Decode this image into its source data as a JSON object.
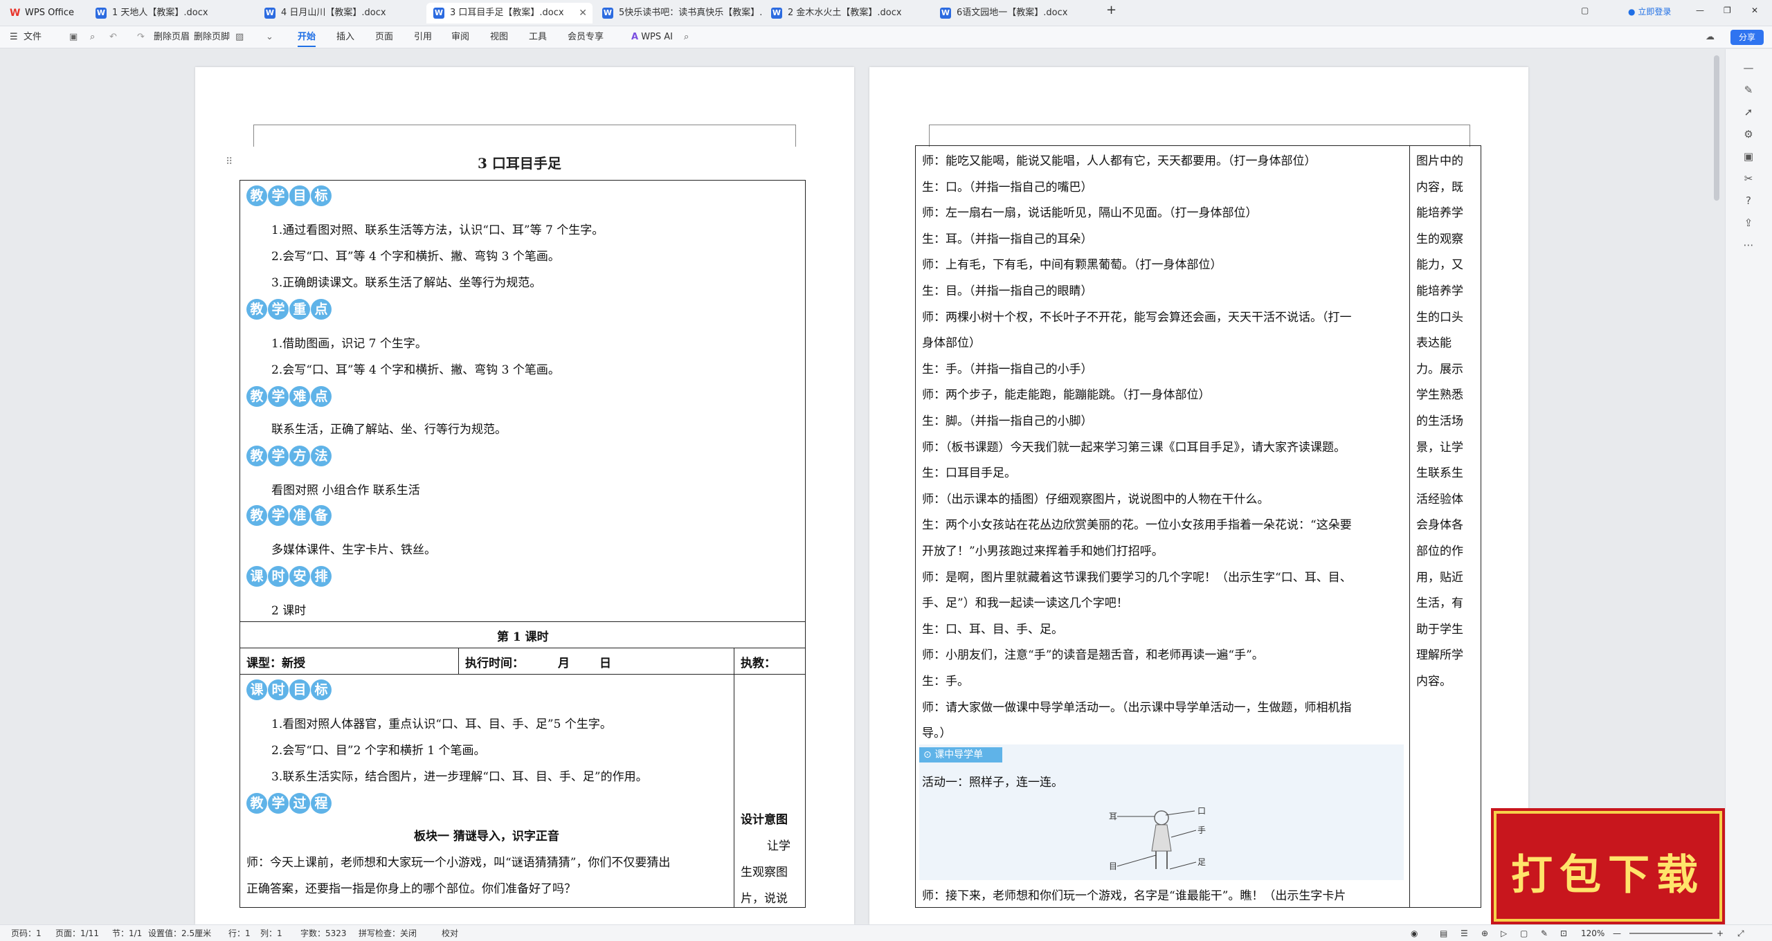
{
  "app": {
    "name": "WPS Office"
  },
  "tabs": [
    {
      "label": "1 天地人【教案】.docx"
    },
    {
      "label": "4 日月山川【教案】.docx"
    },
    {
      "label": "3 口耳目手足【教案】.docx"
    },
    {
      "label": "5快乐读书吧：读书真快乐【教案】.d"
    },
    {
      "label": "2 金木水火土【教案】.docx"
    },
    {
      "label": "6语文园地一【教案】.docx"
    }
  ],
  "topbar": {
    "login": "立即登录",
    "new_tab": "+"
  },
  "menu": {
    "file": "文件",
    "del_header": "删除页眉",
    "del_footer": "删除页脚",
    "items": [
      "开始",
      "插入",
      "页面",
      "引用",
      "审阅",
      "视图",
      "工具",
      "会员专享"
    ],
    "ai": "WPS AI",
    "share": "分享"
  },
  "page1": {
    "title": "3  口耳目手足",
    "sections": {
      "goals_badge": [
        "教",
        "学",
        "目",
        "标"
      ],
      "goals": [
        "1.通过看图对照、联系生活等方法，认识“口、耳”等 7 个生字。",
        "2.会写“口、耳”等 4 个字和横折、撇、弯钩 3 个笔画。",
        "3.正确朗读课文。联系生活了解站、坐等行为规范。"
      ],
      "key_badge": [
        "教",
        "学",
        "重",
        "点"
      ],
      "key": [
        "1.借助图画，识记 7 个生字。",
        "2.会写“口、耳”等 4 个字和横折、撇、弯钩 3 个笔画。"
      ],
      "diff_badge": [
        "教",
        "学",
        "难",
        "点"
      ],
      "diff": "联系生活，正确了解站、坐、行等行为规范。",
      "method_badge": [
        "教",
        "学",
        "方",
        "法"
      ],
      "method": "看图对照    小组合作    联系生活",
      "prep_badge": [
        "教",
        "学",
        "准",
        "备"
      ],
      "prep": "多媒体课件、生字卡片、铁丝。",
      "hours_badge": [
        "课",
        "时",
        "安",
        "排"
      ],
      "hours": "2 课时"
    },
    "lesson": "第 1 课时",
    "type_label": "课型：新授",
    "time_label": "执行时间：",
    "month": "月",
    "day": "日",
    "teacher_label": "执教：",
    "lgoals_badge": [
      "课",
      "时",
      "目",
      "标"
    ],
    "lgoals": [
      "1.看图对照人体器官，重点认识“口、耳、目、手、足”5 个生字。",
      "2.会写“口、目”2 个字和横折 1 个笔画。",
      "3.联系生活实际，结合图片，进一步理解“口、耳、目、手、足”的作用。"
    ],
    "process_badge": [
      "教",
      "学",
      "过",
      "程"
    ],
    "block1": "板块一    猜谜导入，识字正音",
    "intro1": "师：今天上课前，老师想和大家玩一个小游戏，叫“谜语猜猜猜”，你们不仅要猜出",
    "intro2": "正确答案，还要指一指是你身上的哪个部位。你们准备好了吗？",
    "design_title": "设计意图",
    "design_lines": [
      "让学",
      "生观察图",
      "片，说说"
    ]
  },
  "page2": {
    "lines": [
      "师：能吃又能喝，能说又能唱，人人都有它，天天都要用。（打一身体部位）",
      "生：口。（并指一指自己的嘴巴）",
      "师：左一扇右一扇，说话能听见，隔山不见面。（打一身体部位）",
      "生：耳。（并指一指自己的耳朵）",
      "师：上有毛，下有毛，中间有颗黑葡萄。（打一身体部位）",
      "生：目。（并指一指自己的眼睛）",
      "师：两棵小树十个杈，不长叶子不开花，能写会算还会画，天天干活不说话。（打一",
      "身体部位）",
      "生：手。（并指一指自己的小手）",
      "师：两个步子，能走能跑，能蹦能跳。（打一身体部位）",
      "生：脚。（并指一指自己的小脚）",
      "师：（板书课题）今天我们就一起来学习第三课《口耳目手足》，请大家齐读课题。",
      "生：口耳目手足。",
      "师：（出示课本的插图）仔细观察图片，说说图中的人物在干什么。",
      "生：两个小女孩站在花丛边欣赏美丽的花。一位小女孩用手指着一朵花说：“这朵要",
      "开放了！”小男孩跑过来挥着手和她们打招呼。",
      "师：是啊，图片里就藏着这节课我们要学习的几个字呢！（出示生字“口、耳、目、",
      "手、足”）和我一起读一读这几个字吧！",
      "生：口、耳、目、手、足。",
      "师：小朋友们，注意“手”的读音是翘舌音，和老师再读一遍“手”。",
      "生：手。",
      "师：请大家做一做课中导学单活动一。（出示课中导学单活动一，生做题，师相机指",
      "导。）"
    ],
    "guide_label": "课中导学单",
    "activity": "活动一：照样子，连一连。",
    "figure_labels": {
      "left_top": "耳",
      "left_bottom": "目",
      "right_top": "口",
      "right_mid": "手",
      "right_bottom": "足"
    },
    "last_line": "师：接下来，老师想和你们玩一个游戏，名字是“谁最能干”。瞧！（出示生字卡片",
    "side_lines": [
      "图片中的",
      "内容，既",
      "能培养学",
      "生的观察",
      "能力，又",
      "能培养学",
      "生的口头",
      "表达能",
      "力。展示",
      "学生熟悉",
      "的生活场",
      "景，让学",
      "生联系生",
      "活经验体",
      "会身体各",
      "部位的作",
      "用，贴近",
      "生活，有",
      "助于学生",
      "理解所学",
      "内容。"
    ]
  },
  "promo": {
    "text": "打包下载"
  },
  "status": {
    "page": "页码：1",
    "pages": "页面：1/11",
    "section": "节：1/1",
    "setting": "设置值：2.5厘米",
    "row": "行：1",
    "col": "列：1",
    "words": "字数：5323",
    "spell": "拼写检查：关闭",
    "proof": "校对",
    "zoom": "120%"
  }
}
